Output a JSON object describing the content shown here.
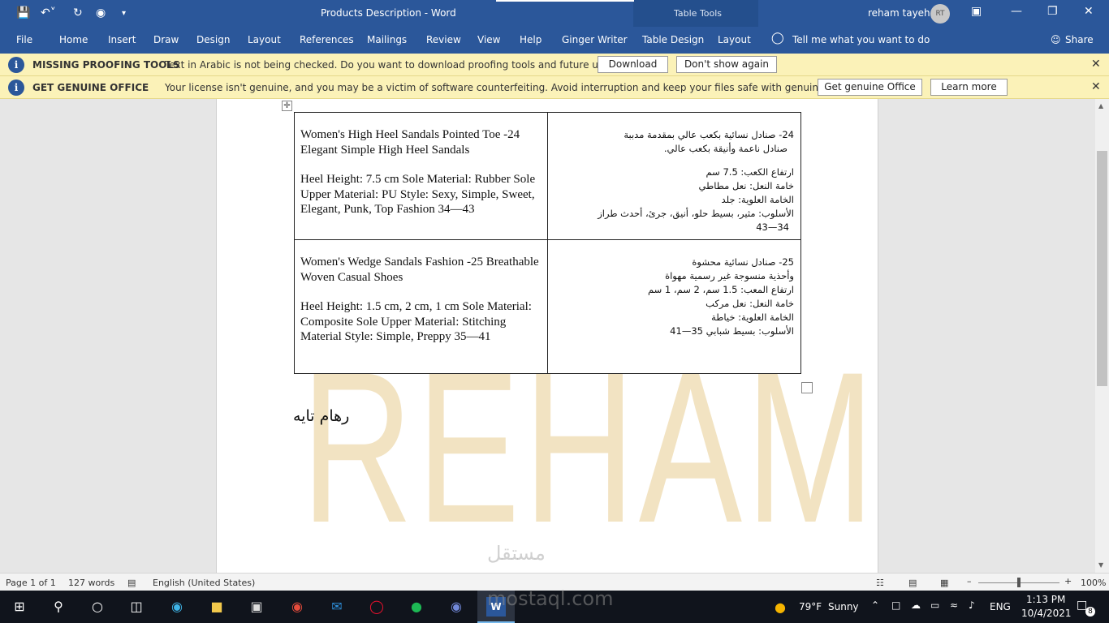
{
  "titlebar": {
    "title": "Products Description  -  Word",
    "table_tools": "Table Tools",
    "user_name": "reham tayeh",
    "user_initials": "RT"
  },
  "ribbon": {
    "tabs": [
      "File",
      "Home",
      "Insert",
      "Draw",
      "Design",
      "Layout",
      "References",
      "Mailings",
      "Review",
      "View",
      "Help",
      "Ginger Writer",
      "Table Design",
      "Layout"
    ],
    "tell_me": "Tell me what you want to do",
    "share": "Share"
  },
  "proofing_bar": {
    "heading": "MISSING PROOFING TOOLS",
    "message": "Text in Arabic is not being checked. Do you want to download proofing tools and future updates?",
    "download_label": "Download",
    "dont_show_label": "Don't show again"
  },
  "genuine_bar": {
    "heading": "GET GENUINE OFFICE",
    "message": "Your license isn't genuine, and you may be a victim of software counterfeiting. Avoid interruption and keep your files safe with genuine Office today.",
    "get_genuine_label": "Get genuine Office",
    "learn_more_label": "Learn more"
  },
  "document": {
    "watermark": "REHAM",
    "rows": [
      {
        "en_title": "Women's High Heel Sandals Pointed Toe  -24 Elegant Simple High Heel Sandals",
        "en_body": "Heel Height: 7.5 cm   Sole Material: Rubber Sole     Upper Material: PU Style: Sexy, Simple, Sweet, Elegant, Punk, Top Fashion   34—43",
        "ar_lines": [
          "24- صنادل نسائية بكعب عالي بمقدمة مدببة",
          "صنادل ناعمة وأنيقة بكعب عالي.",
          "",
          "ارتفاع الكعب: 7.5 سم",
          "خامة النعل: نعل مطاطي",
          "الخامة العلوية: جلد",
          "الأسلوب: مثير، بسيط حلو، أنيق، جرئ، أحدث طراز",
          "34—43"
        ]
      },
      {
        "en_title": "Women's Wedge Sandals Fashion  -25 Breathable Woven Casual Shoes",
        "en_body": "Heel Height: 1.5 cm, 2 cm, 1 cm   Sole Material: Composite Sole Upper Material: Stitching Material Style: Simple, Preppy 35—41",
        "ar_lines": [
          "25- صنادل نسائية محشوة",
          "وأحذية منسوجة غير رسمية مهواة",
          "ارتفاع المعب: 1.5 سم، 2 سم، 1 سم",
          "خامة النعل: نعل مركب",
          "الخامة العلوية: خياطة",
          "الأسلوب: بسيط شبابي 35—41"
        ]
      }
    ],
    "signature": "رهام تايه"
  },
  "statusbar": {
    "page": "Page 1 of 1",
    "words": "127 words",
    "language": "English (United States)",
    "zoom": "100%"
  },
  "watermark_site": "مستقل",
  "watermark_site_latin": "mostaql.com",
  "taskbar": {
    "temperature": "79°F",
    "weather": "Sunny",
    "lang": "ENG",
    "time": "1:13 PM",
    "date": "10/4/2021",
    "notifications": "8"
  }
}
